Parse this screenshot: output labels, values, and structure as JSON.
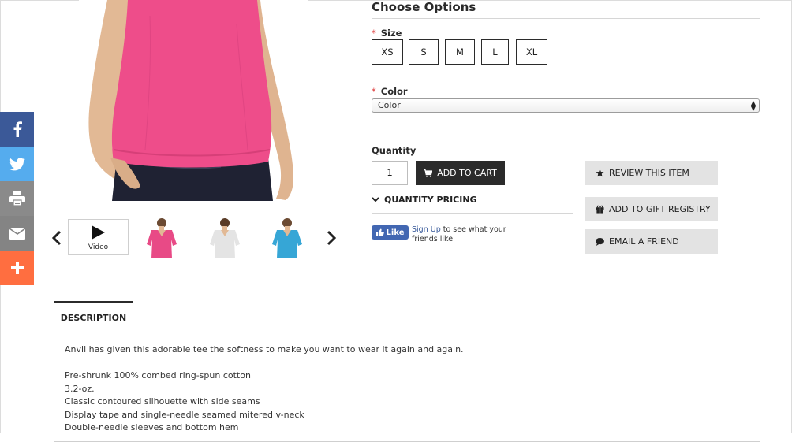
{
  "social": {
    "items": [
      {
        "name": "facebook",
        "icon": "facebook-icon",
        "color": "#3b5998"
      },
      {
        "name": "twitter",
        "icon": "twitter-icon",
        "color": "#55acee"
      },
      {
        "name": "print",
        "icon": "print-icon",
        "color": "#8a8a8a"
      },
      {
        "name": "email",
        "icon": "email-icon",
        "color": "#848484"
      },
      {
        "name": "more",
        "icon": "plus-icon",
        "color": "#ff6e40"
      }
    ]
  },
  "gallery": {
    "video_label": "Video",
    "thumb_colors": [
      "#e84a86",
      "#e4e4e4",
      "#36a6d6"
    ],
    "main_color": "#ee4d8a"
  },
  "options": {
    "title": "Choose Options",
    "size_label": "Size",
    "sizes": [
      "XS",
      "S",
      "M",
      "L",
      "XL"
    ],
    "color_label": "Color",
    "color_selected": "Color",
    "required_marker": "*"
  },
  "purchase": {
    "quantity_label": "Quantity",
    "quantity_value": "1",
    "add_to_cart": "ADD TO CART",
    "quantity_pricing": "QUANTITY PRICING"
  },
  "facebook_like": {
    "button": "Like",
    "signup_link": "Sign Up",
    "text": " to see what your friends like."
  },
  "actions": {
    "review": "REVIEW THIS ITEM",
    "gift_registry": "ADD TO GIFT REGISTRY",
    "email_friend": "EMAIL A FRIEND"
  },
  "description": {
    "tab_label": "DESCRIPTION",
    "intro": "Anvil has given this adorable tee the softness to make you want to wear it again and again.",
    "features": [
      "Pre-shrunk 100% combed ring-spun cotton",
      "3.2-oz.",
      "Classic contoured silhouette with side seams",
      "Display tape and single-needle seamed mitered v-neck",
      "Double-needle sleeves and bottom hem"
    ]
  }
}
